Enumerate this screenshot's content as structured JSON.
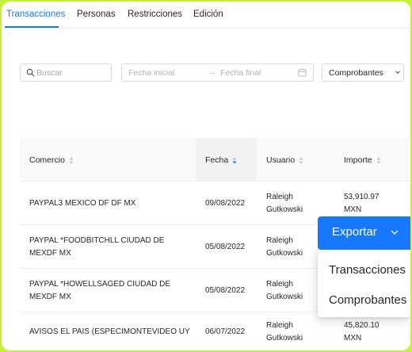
{
  "tabs": [
    {
      "label": "Transacciones",
      "active": true
    },
    {
      "label": "Personas",
      "active": false
    },
    {
      "label": "Restricciones",
      "active": false
    },
    {
      "label": "Edición",
      "active": false
    }
  ],
  "filters": {
    "search_placeholder": "Buscar",
    "start_date_placeholder": "Fecha inicial",
    "range_arrow": "→",
    "end_date_placeholder": "Fecha final",
    "select_value": "Comprobantes"
  },
  "table": {
    "columns": [
      "Comercio",
      "Fecha",
      "Usuario",
      "Importe"
    ],
    "sorted_column": "Fecha",
    "rows": [
      {
        "merchant_line1": "PAYPAL3 MEXICO DF DF MX",
        "merchant_line2": "",
        "date": "09/08/2022",
        "user_line1": "Raleigh",
        "user_line2": "Gutkowski",
        "amount_line1": "53,910.97",
        "amount_line2": "MXN"
      },
      {
        "merchant_line1": "PAYPAL *FOODBITCHLL CIUDAD DE",
        "merchant_line2": "MEXDF MX",
        "date": "05/08/2022",
        "user_line1": "Raleigh",
        "user_line2": "Gutkowski",
        "amount_line1": "",
        "amount_line2": ""
      },
      {
        "merchant_line1": "PAYPAL *HOWELLSAGED CIUDAD DE",
        "merchant_line2": "MEXDF MX",
        "date": "05/08/2022",
        "user_line1": "Raleigh",
        "user_line2": "Gutkowski",
        "amount_line1": "",
        "amount_line2": ""
      },
      {
        "merchant_line1": "AVISOS EL PAIS (ESPECIMONTEVIDEO UY",
        "merchant_line2": "",
        "date": "06/07/2022",
        "user_line1": "Raleigh",
        "user_line2": "Gutkowski",
        "amount_line1": "45,820.10",
        "amount_line2": "MXN"
      }
    ]
  },
  "export": {
    "button_label": "Exportar",
    "menu_items": [
      "Transacciones",
      "Comprobantes"
    ]
  },
  "colors": {
    "accent": "#1677ff",
    "outer_border": "#c6f03a"
  }
}
